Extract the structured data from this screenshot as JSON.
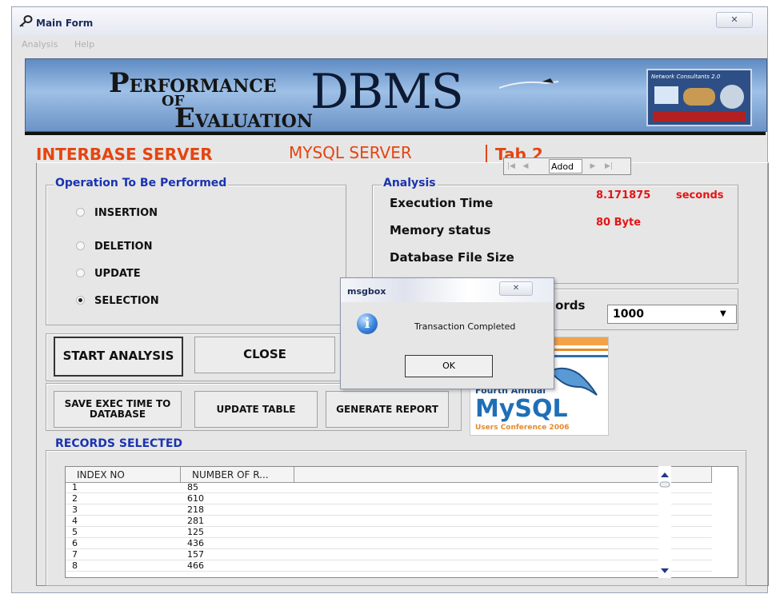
{
  "window": {
    "title": "Main Form",
    "close_label": "✕",
    "menu": [
      "Analysis",
      "Help"
    ]
  },
  "banner": {
    "perf_first": "P",
    "perf_rest": "ERFORMANCE",
    "of": "OF",
    "eval_first": "E",
    "eval_rest": "VALUATION",
    "dbms": "DBMS",
    "book_title": "Network Consultants 2.0"
  },
  "tabs": [
    "INTERBASE SERVER",
    "MYSQL SERVER",
    "Tab 2"
  ],
  "datanav": {
    "caption": "Adod",
    "first": "|◀",
    "prev": "◀",
    "next": "▶",
    "last": "▶|"
  },
  "operations": {
    "legend": "Operation To Be Performed",
    "options": [
      {
        "label": "INSERTION",
        "checked": false
      },
      {
        "label": "DELETION",
        "checked": false
      },
      {
        "label": "UPDATE",
        "checked": false
      },
      {
        "label": "SELECTION",
        "checked": true
      }
    ]
  },
  "analysis": {
    "legend": "Analysis",
    "execution_time_label": "Execution Time",
    "execution_time_value": "8.171875",
    "execution_time_unit": "seconds",
    "memory_label": "Memory status",
    "memory_value": "80 Byte",
    "db_size_label": "Database File Size"
  },
  "records": {
    "label_partial": "ecords",
    "combo_value": "1000"
  },
  "buttons": {
    "start_analysis": "START ANALYSIS",
    "close": "CLOSE",
    "save_exec_time": "SAVE EXEC TIME TO DATABASE",
    "update_table": "UPDATE TABLE",
    "generate_report": "GENERATE REPORT"
  },
  "mysql_logo": {
    "line1": "Fourth Annual",
    "brand": "MySQL",
    "line2": "Users Conference 2006"
  },
  "records_selected": {
    "legend": "RECORDS SELECTED",
    "columns": [
      "INDEX NO",
      "NUMBER OF R..."
    ],
    "rows": [
      [
        "1",
        "85"
      ],
      [
        "2",
        "610"
      ],
      [
        "3",
        "218"
      ],
      [
        "4",
        "281"
      ],
      [
        "5",
        "125"
      ],
      [
        "6",
        "436"
      ],
      [
        "7",
        "157"
      ],
      [
        "8",
        "466"
      ]
    ]
  },
  "msgbox": {
    "title": "msgbox",
    "close_label": "✕",
    "icon": "i",
    "message": "Transaction Completed",
    "ok": "OK"
  }
}
